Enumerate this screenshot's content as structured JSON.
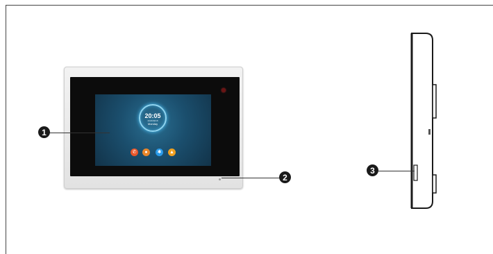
{
  "screen": {
    "time": "20:05",
    "date": "2023/09/18",
    "day": "Monday",
    "apps": [
      {
        "icon": "phone-icon",
        "glyph": "✆",
        "color": "#e8562a"
      },
      {
        "icon": "camera-icon",
        "glyph": "●",
        "color": "#e8862a"
      },
      {
        "icon": "user-icon",
        "glyph": "✱",
        "color": "#2a9ae8"
      },
      {
        "icon": "arrow-icon",
        "glyph": "▲",
        "color": "#f0a020"
      }
    ]
  },
  "callouts": [
    {
      "number": "1"
    },
    {
      "number": "2"
    },
    {
      "number": "3"
    }
  ]
}
